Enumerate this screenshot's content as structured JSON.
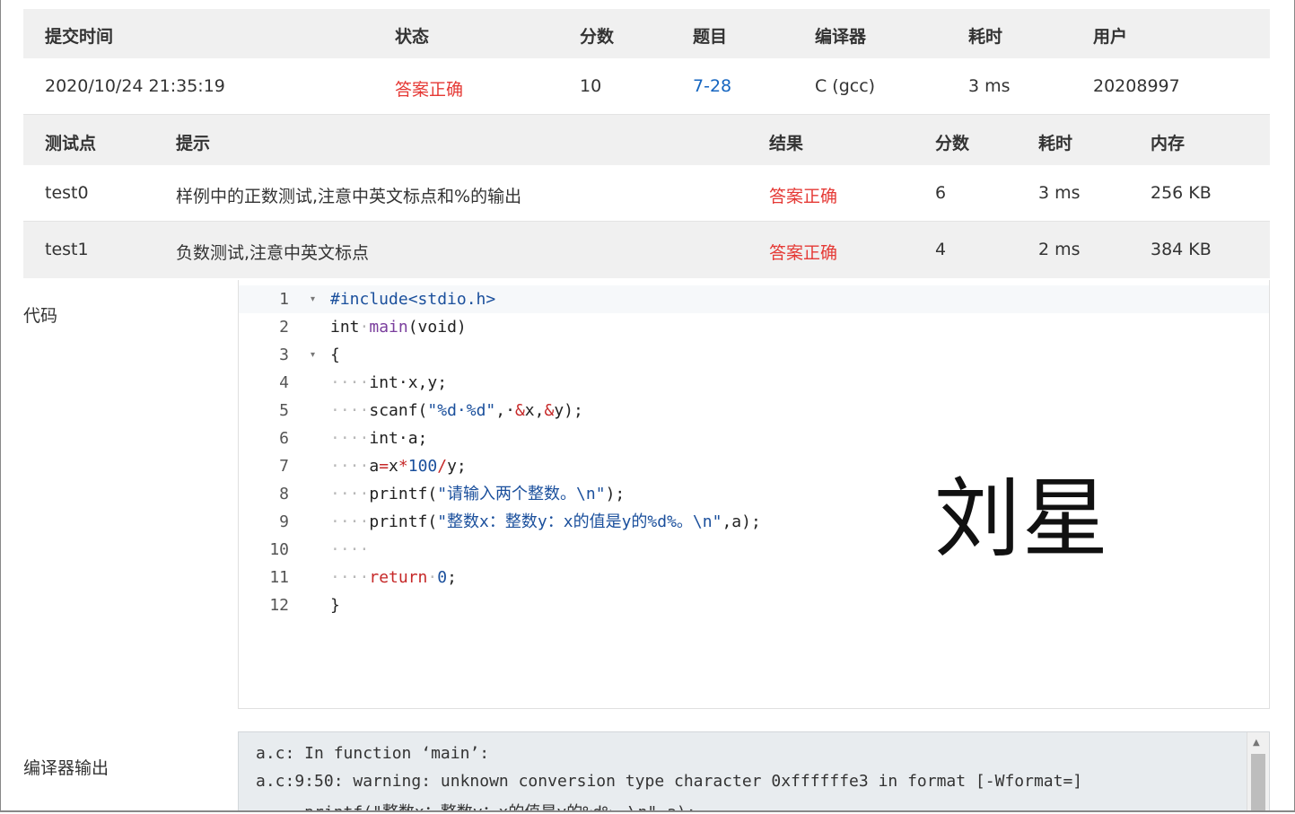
{
  "submission": {
    "headers": [
      "提交时间",
      "状态",
      "分数",
      "题目",
      "编译器",
      "耗时",
      "用户"
    ],
    "time": "2020/10/24 21:35:19",
    "status": "答案正确",
    "score": "10",
    "problem": "7-28",
    "compiler": "C (gcc)",
    "elapsed": "3 ms",
    "user": "20208997"
  },
  "tests": {
    "headers": [
      "测试点",
      "提示",
      "结果",
      "分数",
      "耗时",
      "内存"
    ],
    "rows": [
      {
        "name": "test0",
        "hint": "样例中的正数测试,注意中英文标点和%的输出",
        "result": "答案正确",
        "score": "6",
        "time": "3 ms",
        "memory": "256 KB"
      },
      {
        "name": "test1",
        "hint": "负数测试,注意中英文标点",
        "result": "答案正确",
        "score": "4",
        "time": "2 ms",
        "memory": "384 KB"
      }
    ]
  },
  "code_label": "代码",
  "code": {
    "line_numbers": [
      "1",
      "2",
      "3",
      "4",
      "5",
      "6",
      "7",
      "8",
      "9",
      "10",
      "11",
      "12"
    ],
    "l1": "#include<stdio.h>",
    "l2a": "int",
    "l2b": "·",
    "l2c": "main",
    "l2d": "(void)",
    "l3": "{",
    "indent": "····",
    "l4": "int·x,y;",
    "l5a": "scanf(",
    "l5b": "\"%d·%d\"",
    "l5c": ",·",
    "l5d": "&",
    "l5e": "x,",
    "l5f": "&",
    "l5g": "y);",
    "l6": "int·a;",
    "l7a": "a",
    "l7b": "=",
    "l7c": "x",
    "l7d": "*",
    "l7e": "100",
    "l7f": "/",
    "l7g": "y;",
    "l8a": "printf(",
    "l8b": "\"请输入两个整数。\\n\"",
    "l8c": ");",
    "l9a": "printf(",
    "l9b": "\"整数x：整数y：x的值是y的%d%。\\n\"",
    "l9c": ",a);",
    "l11a": "return",
    "l11b": "·",
    "l11c": "0",
    "l11d": ";",
    "l12": "}"
  },
  "watermark": "刘星",
  "compiler_output_label": "编译器输出",
  "compiler_output": {
    "line1": "a.c: In function ‘main’:",
    "line2": "a.c:9:50: warning: unknown conversion type character 0xffffffe3 in format [-Wformat=]",
    "line3": "     printf(\"整数x：整数y：x的值是y的%d%。\\n\",a);"
  },
  "colors": {
    "status_ok": "#e53935",
    "link": "#1565c0",
    "header_bg": "#f0f0f0"
  }
}
